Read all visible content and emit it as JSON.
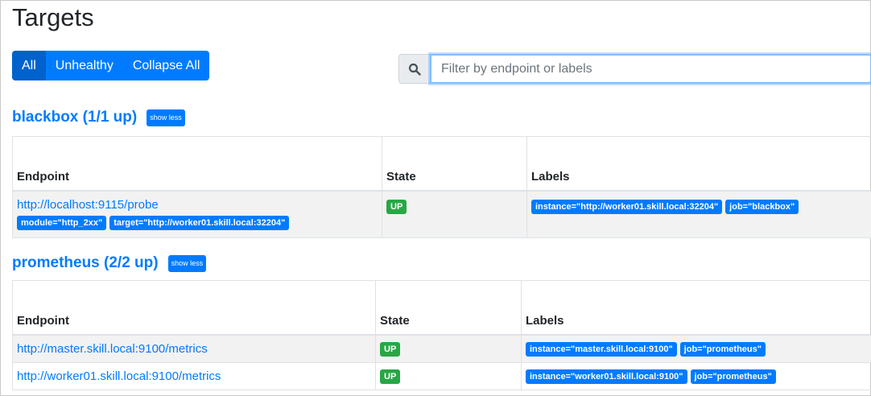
{
  "page": {
    "title": "Targets"
  },
  "filters": {
    "all": "All",
    "unhealthy": "Unhealthy",
    "collapse": "Collapse All"
  },
  "search": {
    "placeholder": "Filter by endpoint or labels"
  },
  "columns": {
    "endpoint": "Endpoint",
    "state": "State",
    "labels": "Labels"
  },
  "pools": [
    {
      "title": "blackbox (1/1 up)",
      "toggle": "show less",
      "targets": [
        {
          "endpoint": "http://localhost:9115/probe",
          "params": [
            "module=\"http_2xx\"",
            "target=\"http://worker01.skill.local:32204\""
          ],
          "state": "UP",
          "labels": [
            "instance=\"http://worker01.skill.local:32204\"",
            "job=\"blackbox\""
          ]
        }
      ]
    },
    {
      "title": "prometheus (2/2 up)",
      "toggle": "show less",
      "targets": [
        {
          "endpoint": "http://master.skill.local:9100/metrics",
          "state": "UP",
          "labels": [
            "instance=\"master.skill.local:9100\"",
            "job=\"prometheus\""
          ]
        },
        {
          "endpoint": "http://worker01.skill.local:9100/metrics",
          "state": "UP",
          "labels": [
            "instance=\"worker01.skill.local:9100\"",
            "job=\"prometheus\""
          ]
        }
      ]
    }
  ],
  "colors": {
    "primary": "#007bff",
    "active": "#0062cc",
    "success": "#28a745"
  }
}
